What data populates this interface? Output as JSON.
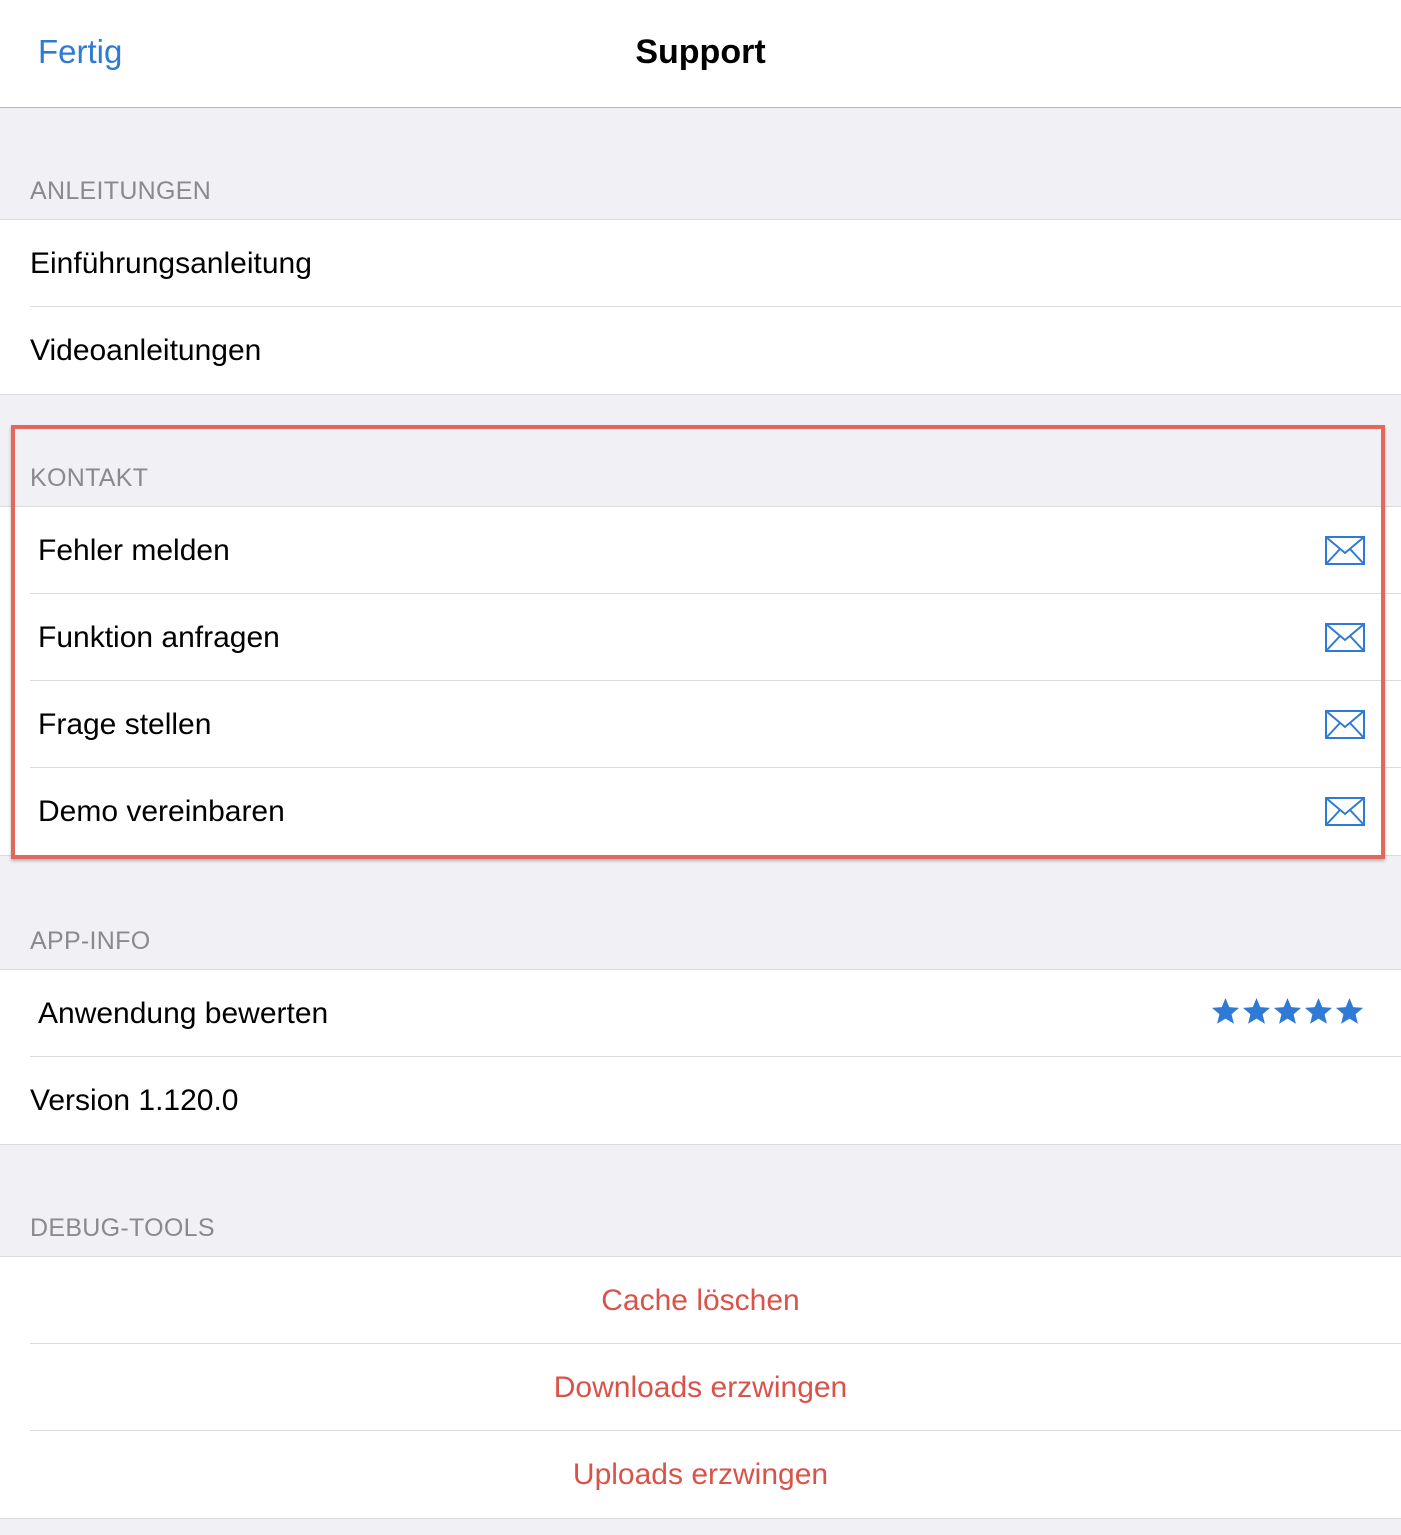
{
  "navbar": {
    "done_label": "Fertig",
    "title": "Support"
  },
  "sections": {
    "anleitungen": {
      "header": "ANLEITUNGEN",
      "items": [
        "Einführungsanleitung",
        "Videoanleitungen"
      ]
    },
    "kontakt": {
      "header": "KONTAKT",
      "items": [
        "Fehler melden",
        "Funktion anfragen",
        "Frage stellen",
        "Demo vereinbaren"
      ],
      "item_icon": "mail-icon"
    },
    "app_info": {
      "header": "APP-INFO",
      "rate_label": "Anwendung bewerten",
      "rating": 5,
      "rating_max": 5,
      "version_label": "Version 1.120.0"
    },
    "debug_tools": {
      "header": "DEBUG-TOOLS",
      "items": [
        "Cache löschen",
        "Downloads erzwingen",
        "Uploads erzwingen"
      ]
    }
  },
  "colors": {
    "accent": "#2f7ad4",
    "destructive": "#d9534a",
    "highlight": "#e4675b",
    "star": "#2f7ad4"
  }
}
